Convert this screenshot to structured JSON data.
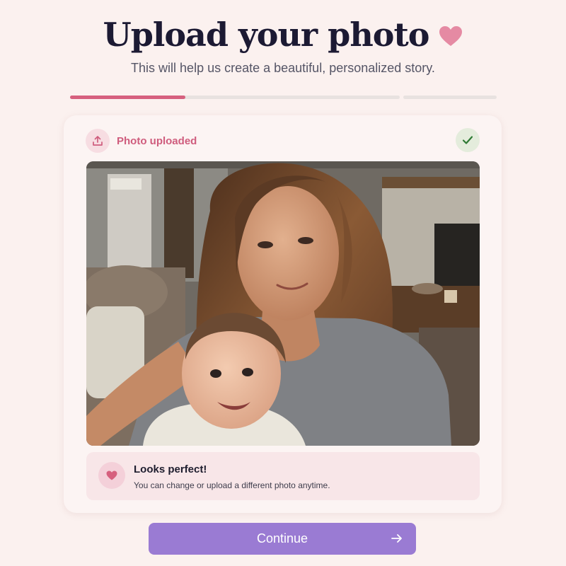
{
  "header": {
    "title": "Upload your photo",
    "subtitle": "This will help us create a beautiful, personalized story."
  },
  "progress": {
    "steps": 2,
    "current_step": 1,
    "current_step_fill": 0.35
  },
  "upload": {
    "status_label": "Photo uploaded",
    "status": "success"
  },
  "notice": {
    "title": "Looks perfect!",
    "message": "You can change or upload a different photo anytime."
  },
  "actions": {
    "continue_label": "Continue"
  },
  "colors": {
    "accent_pink": "#d6607e",
    "button_purple": "#9a7bd3",
    "success_green": "#2f7a34",
    "background": "#fbf1ef"
  }
}
